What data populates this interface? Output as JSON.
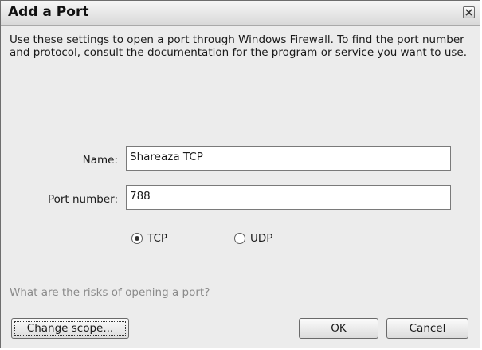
{
  "window": {
    "title": "Add a Port"
  },
  "description": "Use these settings to open a port through Windows Firewall. To find the port number and protocol, consult the documentation for the program or service you want to use.",
  "form": {
    "name_label": "Name:",
    "name_value": "Shareaza TCP",
    "port_label": "Port number:",
    "port_value": "788",
    "protocol": {
      "selected": "TCP",
      "options": [
        "TCP",
        "UDP"
      ]
    }
  },
  "help_link": "What are the risks of opening a port?",
  "buttons": {
    "change_scope": "Change scope...",
    "ok": "OK",
    "cancel": "Cancel"
  }
}
